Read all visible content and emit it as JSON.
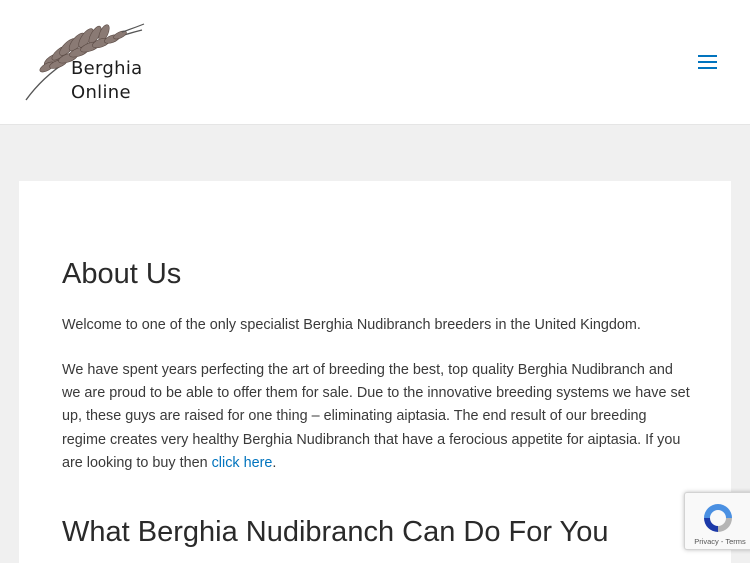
{
  "header": {
    "logo_line1": "Berghia",
    "logo_line2": "Online",
    "menu_icon": "hamburger-menu-icon",
    "accent_color": "#0274be"
  },
  "main": {
    "title": "About Us",
    "paragraph1": "Welcome to one of the only specialist Berghia Nudibranch breeders in the United Kingdom.",
    "paragraph2": "We have spent years perfecting the art of breeding the best, top quality Berghia Nudibranch and we are proud to be able to offer them for sale. Due to the innovative breeding systems we have set up, these guys are raised for one thing – eliminating aiptasia. The end result of our breeding regime creates very healthy Berghia Nudibranch that have a ferocious appetite for aiptasia. If you are looking to buy then ",
    "link_text": "click here",
    "paragraph2_end": ".",
    "section_title": "What Berghia Nudibranch Can Do For You"
  },
  "recaptcha": {
    "links": "Privacy - Terms"
  }
}
